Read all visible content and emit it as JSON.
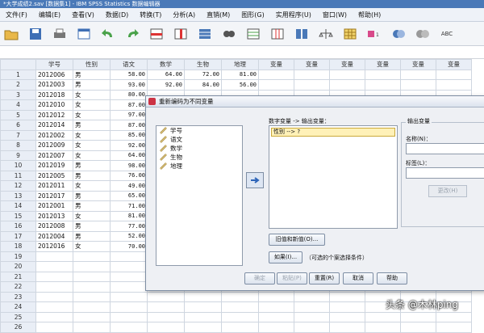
{
  "window": {
    "title": "*大学成绩2.sav [数据集1] - IBM SPSS Statistics 数据编辑器"
  },
  "menu": [
    "文件(F)",
    "编辑(E)",
    "查看(V)",
    "数据(D)",
    "转换(T)",
    "分析(A)",
    "直销(M)",
    "图形(G)",
    "实用程序(U)",
    "窗口(W)",
    "帮助(H)"
  ],
  "toolbar": {
    "icons": [
      "open-folder-icon",
      "save-icon",
      "print-icon",
      "dialog-recall-icon",
      "undo-icon",
      "redo-icon",
      "goto-case-icon",
      "goto-variable-icon",
      "variables-icon",
      "find-icon",
      "insert-cases-icon",
      "insert-variable-icon",
      "split-file-icon",
      "weight-cases-icon",
      "select-cases-icon",
      "value-labels-icon",
      "use-sets-icon",
      "show-all-icon",
      "spell-check-icon"
    ],
    "spell_label": "ABC"
  },
  "grid": {
    "headers": [
      "学号",
      "性别",
      "语文",
      "数学",
      "生物",
      "地理",
      "变量",
      "变量",
      "变量",
      "变量",
      "变量",
      "变量"
    ],
    "rows": [
      {
        "n": "1",
        "id": "2012006",
        "sex": "男",
        "chinese": "58.00",
        "math": "64.00",
        "bio": "72.00",
        "geo": "81.00"
      },
      {
        "n": "2",
        "id": "2012003",
        "sex": "男",
        "chinese": "93.00",
        "math": "92.00",
        "bio": "84.00",
        "geo": "56.00"
      },
      {
        "n": "3",
        "id": "2012018",
        "sex": "女",
        "chinese": "80.00",
        "math": "",
        "bio": "",
        "geo": ""
      },
      {
        "n": "4",
        "id": "2012010",
        "sex": "女",
        "chinese": "87.00",
        "math": "",
        "bio": "",
        "geo": ""
      },
      {
        "n": "5",
        "id": "2012012",
        "sex": "女",
        "chinese": "97.00",
        "math": "",
        "bio": "",
        "geo": ""
      },
      {
        "n": "6",
        "id": "2012014",
        "sex": "男",
        "chinese": "87.00",
        "math": "",
        "bio": "",
        "geo": ""
      },
      {
        "n": "7",
        "id": "2012002",
        "sex": "女",
        "chinese": "85.00",
        "math": "",
        "bio": "",
        "geo": ""
      },
      {
        "n": "8",
        "id": "2012009",
        "sex": "女",
        "chinese": "92.00",
        "math": "",
        "bio": "",
        "geo": ""
      },
      {
        "n": "9",
        "id": "2012007",
        "sex": "女",
        "chinese": "64.00",
        "math": "",
        "bio": "",
        "geo": ""
      },
      {
        "n": "10",
        "id": "2012019",
        "sex": "男",
        "chinese": "98.00",
        "math": "",
        "bio": "",
        "geo": ""
      },
      {
        "n": "11",
        "id": "2012005",
        "sex": "男",
        "chinese": "76.00",
        "math": "",
        "bio": "",
        "geo": ""
      },
      {
        "n": "12",
        "id": "2012011",
        "sex": "女",
        "chinese": "49.00",
        "math": "",
        "bio": "",
        "geo": ""
      },
      {
        "n": "13",
        "id": "2012017",
        "sex": "男",
        "chinese": "65.00",
        "math": "",
        "bio": "",
        "geo": ""
      },
      {
        "n": "14",
        "id": "2012001",
        "sex": "男",
        "chinese": "71.00",
        "math": "",
        "bio": "",
        "geo": ""
      },
      {
        "n": "15",
        "id": "2012013",
        "sex": "女",
        "chinese": "81.00",
        "math": "",
        "bio": "",
        "geo": ""
      },
      {
        "n": "16",
        "id": "2012008",
        "sex": "男",
        "chinese": "77.00",
        "math": "",
        "bio": "",
        "geo": ""
      },
      {
        "n": "17",
        "id": "2012004",
        "sex": "男",
        "chinese": "52.00",
        "math": "",
        "bio": "",
        "geo": ""
      },
      {
        "n": "18",
        "id": "2012016",
        "sex": "女",
        "chinese": "70.00",
        "math": "",
        "bio": "",
        "geo": ""
      },
      {
        "n": "19",
        "id": "",
        "sex": "",
        "chinese": "",
        "math": "",
        "bio": "",
        "geo": ""
      },
      {
        "n": "20",
        "id": "",
        "sex": "",
        "chinese": "",
        "math": "",
        "bio": "",
        "geo": ""
      },
      {
        "n": "21",
        "id": "",
        "sex": "",
        "chinese": "",
        "math": "",
        "bio": "",
        "geo": ""
      },
      {
        "n": "22",
        "id": "",
        "sex": "",
        "chinese": "",
        "math": "",
        "bio": "",
        "geo": ""
      },
      {
        "n": "23",
        "id": "",
        "sex": "",
        "chinese": "",
        "math": "",
        "bio": "",
        "geo": ""
      },
      {
        "n": "24",
        "id": "",
        "sex": "",
        "chinese": "",
        "math": "",
        "bio": "",
        "geo": ""
      },
      {
        "n": "25",
        "id": "",
        "sex": "",
        "chinese": "",
        "math": "",
        "bio": "",
        "geo": ""
      },
      {
        "n": "26",
        "id": "",
        "sex": "",
        "chinese": "",
        "math": "",
        "bio": "",
        "geo": ""
      }
    ]
  },
  "dialog": {
    "title": "重新编码为不同变量",
    "variables": [
      "学号",
      "语文",
      "数学",
      "生物",
      "地理"
    ],
    "mapping_label": "数字变量 -> 输出变量：",
    "mapping_item": "性别 --> ?",
    "output_group_label": "输出变量",
    "name_label": "名称(N)：",
    "label_label": "标签(L)：",
    "change_button": "更改(H)",
    "old_new_button": "旧值和新值(O)...",
    "if_button": "如果(I)...",
    "if_note": "（可选的个案选择条件）",
    "ok": "确定",
    "paste": "粘贴(P)",
    "reset": "重置(R)",
    "cancel": "取消",
    "help": "帮助"
  },
  "watermark": "头条 @木林ping",
  "colors": {
    "titlebar": "#4a79b8",
    "selection": "#fff1b8"
  }
}
